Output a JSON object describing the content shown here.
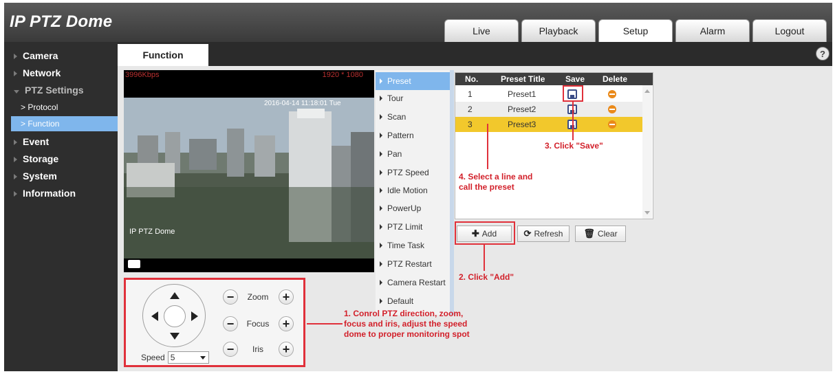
{
  "app": {
    "title": "IP PTZ Dome"
  },
  "header_tabs": [
    {
      "label": "Live"
    },
    {
      "label": "Playback"
    },
    {
      "label": "Setup"
    },
    {
      "label": "Alarm"
    },
    {
      "label": "Logout"
    }
  ],
  "sidebar": {
    "camera": "Camera",
    "network": "Network",
    "ptz_settings": "PTZ Settings",
    "protocol": "> Protocol",
    "function": "> Function",
    "event": "Event",
    "storage": "Storage",
    "system": "System",
    "information": "Information"
  },
  "page_tab": "Function",
  "help_icon": "?",
  "video": {
    "bitrate": "3996Kbps",
    "resolution": "1920 * 1080",
    "timestamp": "2016-04-14 11:18:01 Tue",
    "overlay_name": "IP PTZ Dome"
  },
  "ptz": {
    "zoom_label": "Zoom",
    "focus_label": "Focus",
    "iris_label": "Iris",
    "minus": "−",
    "plus": "+",
    "speed_label": "Speed",
    "speed_value": "5"
  },
  "menu": [
    "Preset",
    "Tour",
    "Scan",
    "Pattern",
    "Pan",
    "PTZ Speed",
    "Idle Motion",
    "PowerUp",
    "PTZ Limit",
    "Time Task",
    "PTZ Restart",
    "Camera Restart",
    "Default"
  ],
  "preset_table": {
    "headers": {
      "no": "No.",
      "title": "Preset Title",
      "save": "Save",
      "delete": "Delete"
    },
    "rows": [
      {
        "no": "1",
        "title": "Preset1"
      },
      {
        "no": "2",
        "title": "Preset2"
      },
      {
        "no": "3",
        "title": "Preset3"
      }
    ]
  },
  "buttons": {
    "add": "Add",
    "refresh": "Refresh",
    "clear": "Clear"
  },
  "annotations": {
    "a1": "1. Conrol PTZ direction, zoom, focus and iris, adjust the speed dome to proper monitoring spot",
    "a2": "2. Click \"Add\"",
    "a3": "3. Click \"Save\"",
    "a4": "4. Select a line and call the preset"
  },
  "colors": {
    "annotation_red": "#e0303a",
    "selected_blue": "#7fb6ec",
    "selected_row": "#f2c82c",
    "delete_orange": "#ea8a1a"
  }
}
